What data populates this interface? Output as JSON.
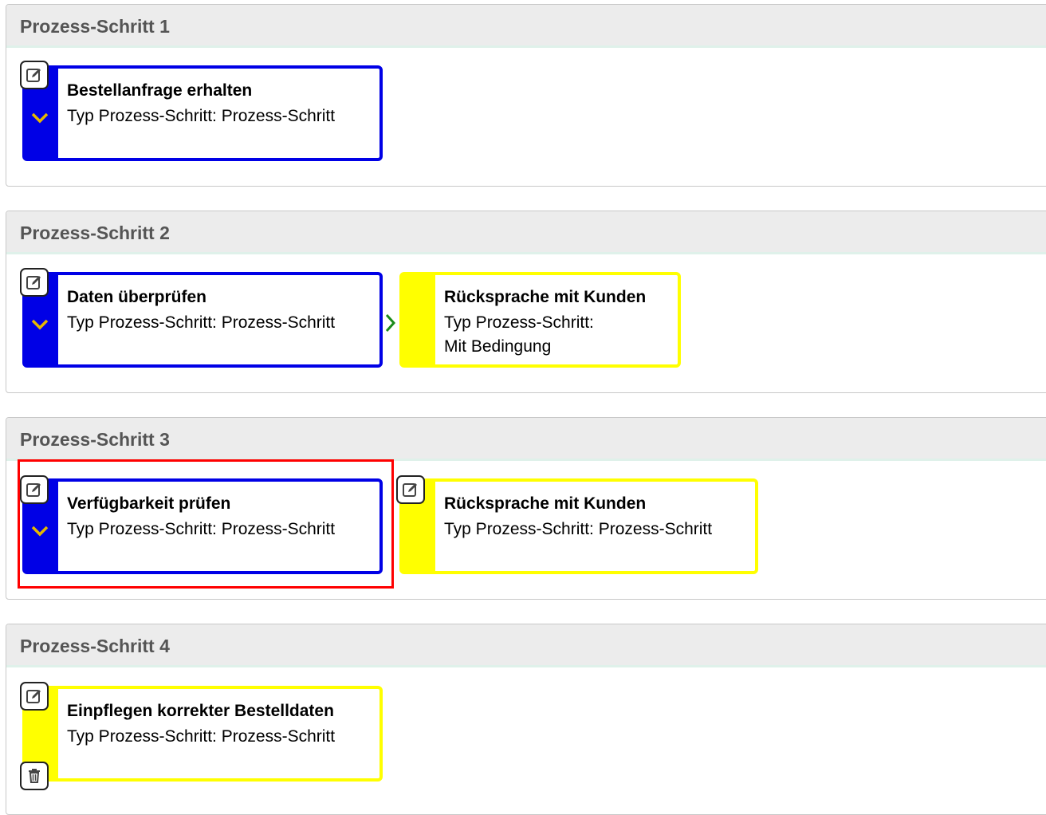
{
  "sections": [
    {
      "header": "Prozess-Schritt 1",
      "cards": [
        {
          "title": "Bestellanfrage erhalten",
          "subtitle": "Typ Prozess-Schritt: Prozess-Schritt",
          "color": "blue"
        }
      ]
    },
    {
      "header": "Prozess-Schritt 2",
      "cards": [
        {
          "title": "Daten überprüfen",
          "subtitle": "Typ Prozess-Schritt: Prozess-Schritt",
          "color": "blue"
        },
        {
          "title": "Rücksprache mit Kunden",
          "subtitle_line1": "Typ Prozess-Schritt:",
          "subtitle_line2": "Mit Bedingung",
          "color": "yellow"
        }
      ]
    },
    {
      "header": "Prozess-Schritt 3",
      "cards": [
        {
          "title": "Verfügbarkeit prüfen",
          "subtitle": "Typ Prozess-Schritt: Prozess-Schritt",
          "color": "blue"
        },
        {
          "title": "Rücksprache mit Kunden",
          "subtitle": "Typ Prozess-Schritt: Prozess-Schritt",
          "color": "yellow"
        }
      ]
    },
    {
      "header": "Prozess-Schritt 4",
      "cards": [
        {
          "title": "Einpflegen korrekter Bestelldaten",
          "subtitle": "Typ Prozess-Schritt: Prozess-Schritt",
          "color": "yellow"
        }
      ]
    }
  ],
  "colors": {
    "blue": "#0000e6",
    "yellow": "#ffff00",
    "chevron": "#e6b800",
    "arrow": "#1a8a1a",
    "highlight": "#ff0000"
  },
  "icons": {
    "edit": "edit-icon",
    "delete": "trash-icon",
    "expand": "chevron-down-icon",
    "connector": "chevron-right-icon"
  }
}
